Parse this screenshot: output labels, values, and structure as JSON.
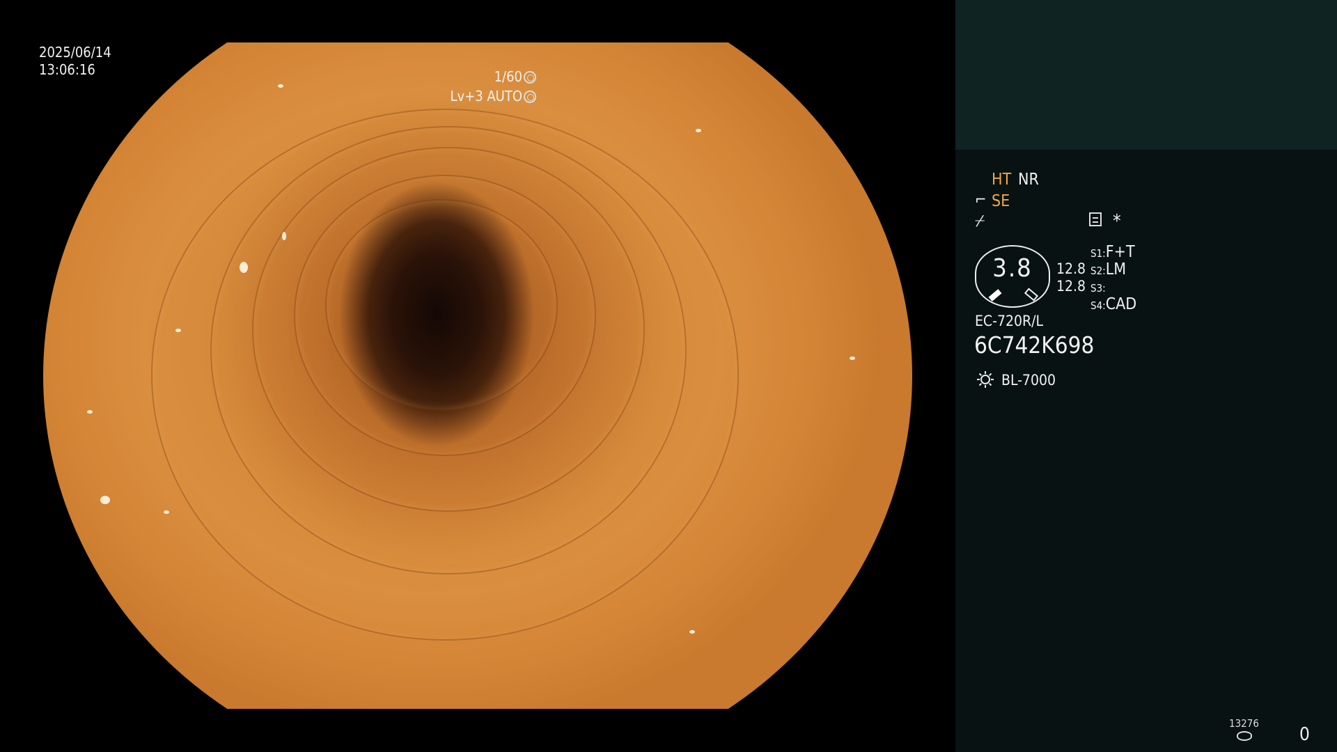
{
  "overlay": {
    "date": "2025/06/14",
    "time": "13:06:16",
    "shutter": "1/60",
    "iris": "Lv+3 AUTO"
  },
  "panel": {
    "ht": "HT",
    "nr": "NR",
    "se": "SE",
    "asterisk": "*",
    "dial_value": "3.8",
    "value_1": "12.8",
    "value_2": "12.8",
    "s1_label": "S1:",
    "s1_value": "F+T",
    "s2_label": "S2:",
    "s2_value": "LM",
    "s3_label": "S3:",
    "s3_value": "",
    "s4_label": "S4:",
    "s4_value": "CAD",
    "scope_model": "EC-720R/L",
    "serial": "6C742K698",
    "light_source": "BL-7000",
    "counter": "13276",
    "zero": "0"
  },
  "icons": [
    "shutter-icon",
    "iris-icon",
    "se-icon",
    "freeze-icon",
    "memo-icon",
    "sun-icon",
    "disk-icon"
  ],
  "colors": {
    "accent_orange": "#f3a93f",
    "panel_bg": "#081212",
    "panel_top": "#0f2323"
  }
}
